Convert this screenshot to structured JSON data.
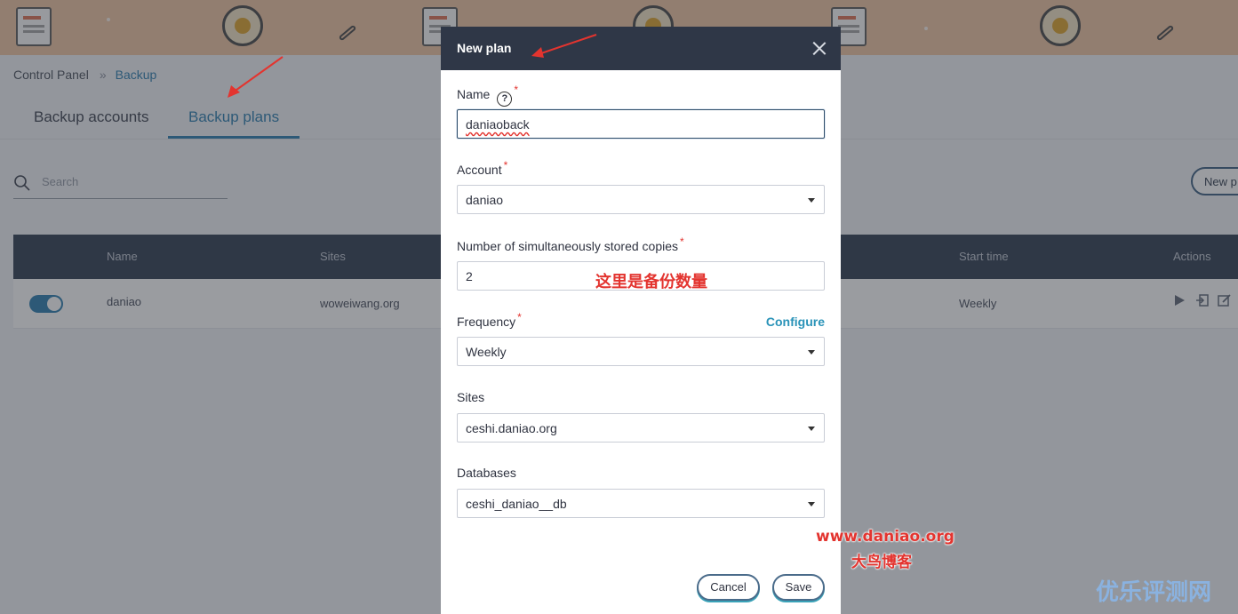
{
  "breadcrumb": {
    "root": "Control Panel",
    "separator": "»",
    "current": "Backup"
  },
  "tabs": [
    {
      "label": "Backup accounts",
      "active": false
    },
    {
      "label": "Backup plans",
      "active": true
    }
  ],
  "search": {
    "placeholder": "Search"
  },
  "new_plan_button": "New p",
  "table": {
    "headers": [
      "Name",
      "Sites",
      "Start time",
      "Actions"
    ],
    "rows": [
      {
        "enabled": true,
        "name": "daniao",
        "sites": "woweiwang.org",
        "start_time": "Weekly",
        "actions": [
          "play-icon",
          "restore-icon",
          "edit-icon"
        ]
      }
    ]
  },
  "modal": {
    "title": "New plan",
    "fields": {
      "name": {
        "label": "Name",
        "required_mark": "*",
        "value": "daniaoback"
      },
      "account": {
        "label": "Account",
        "required_mark": "*",
        "value": "daniao"
      },
      "copies": {
        "label": "Number of simultaneously stored copies",
        "required_mark": "*",
        "value": "2"
      },
      "frequency": {
        "label": "Frequency",
        "required_mark": "*",
        "value": "Weekly",
        "configure": "Configure"
      },
      "sites": {
        "label": "Sites",
        "value": "ceshi.daniao.org"
      },
      "databases": {
        "label": "Databases",
        "value": "ceshi_daniao__db"
      }
    },
    "buttons": {
      "cancel": "Cancel",
      "save": "Save"
    }
  },
  "annotations": {
    "copies_note": "这里是备份数量",
    "watermark_url": "www.daniao.org",
    "watermark_name": "大鸟博客",
    "corner_mark": "优乐评测网"
  },
  "colors": {
    "accent": "#3a86b4",
    "header_dark": "#2f3747",
    "required": "#e3342f",
    "link": "#2a93b8"
  }
}
